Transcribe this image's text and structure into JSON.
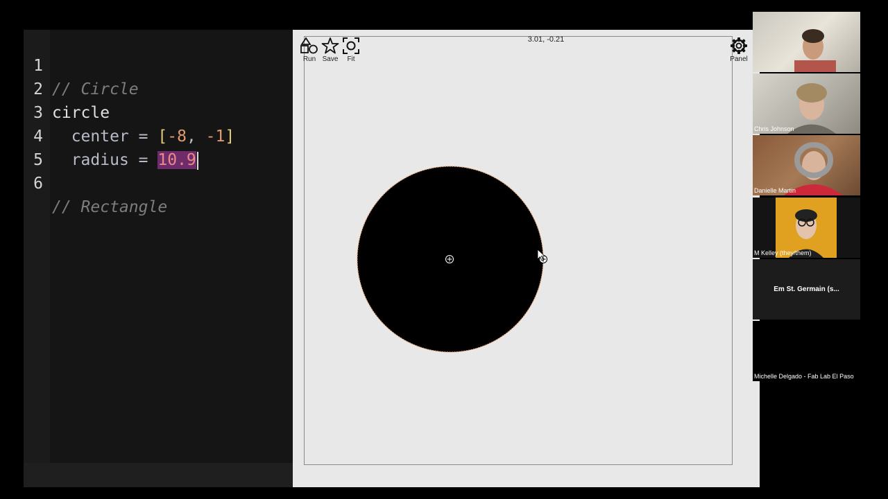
{
  "editor": {
    "lines": [
      {
        "n": "1",
        "comment": "// Circle"
      },
      {
        "n": "2",
        "keyword": "circle"
      },
      {
        "n": "3",
        "prop": "center",
        "eq": "=",
        "open": "[",
        "v1": "-8",
        "comma": ",",
        "v2": "-1",
        "close": "]"
      },
      {
        "n": "4",
        "prop": "radius",
        "eq": "=",
        "value": "10.9"
      },
      {
        "n": "5"
      },
      {
        "n": "6",
        "comment": "// Rectangle"
      }
    ]
  },
  "viewer": {
    "coordinates": "3.01, -0.21",
    "toolbar": {
      "run": "Run",
      "save": "Save",
      "fit": "Fit",
      "panel": "Panel"
    },
    "shape": {
      "type": "circle",
      "center": [
        -8,
        -1
      ],
      "radius": 10.9,
      "fill": "#000000",
      "outline": "#e8a070"
    }
  },
  "participants": [
    {
      "name": ""
    },
    {
      "name": "Chris Johnson"
    },
    {
      "name": "Danielle Martin"
    },
    {
      "name": "M Kelley (they/them)"
    },
    {
      "name": "Em St. Germain (s..."
    },
    {
      "name": "Michelle Delgado - Fab Lab El Paso"
    }
  ]
}
